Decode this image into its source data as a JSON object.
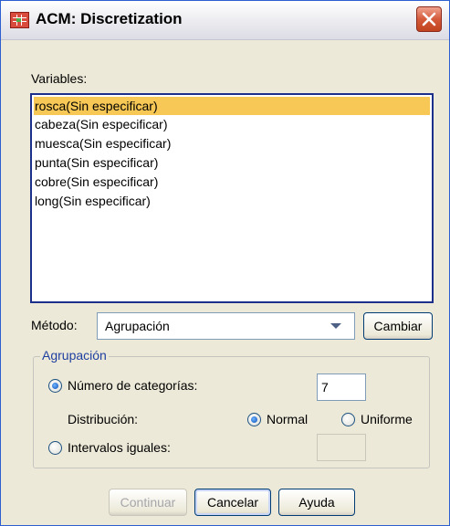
{
  "window": {
    "title": "ACM: Discretization"
  },
  "variables": {
    "label": "Variables:",
    "items": [
      {
        "label": "rosca(Sin especificar)",
        "selected": true
      },
      {
        "label": "cabeza(Sin especificar)",
        "selected": false
      },
      {
        "label": "muesca(Sin especificar)",
        "selected": false
      },
      {
        "label": "punta(Sin especificar)",
        "selected": false
      },
      {
        "label": "cobre(Sin especificar)",
        "selected": false
      },
      {
        "label": "long(Sin especificar)",
        "selected": false
      }
    ]
  },
  "method": {
    "label": "Método:",
    "selected": "Agrupación",
    "change_button": "Cambiar"
  },
  "grouping": {
    "title": "Agrupación",
    "num_categories": {
      "label": "Número de categorías:",
      "checked": true,
      "value": "7"
    },
    "distribution": {
      "label": "Distribución:",
      "normal": {
        "label": "Normal",
        "checked": true
      },
      "uniform": {
        "label": "Uniforme",
        "checked": false
      }
    },
    "equal_intervals": {
      "label": "Intervalos iguales:",
      "checked": false,
      "value": ""
    }
  },
  "buttons": {
    "continue": "Continuar",
    "cancel": "Cancelar",
    "help": "Ayuda"
  },
  "colors": {
    "selection": "#f7c855",
    "window_bg": "#ece9d8",
    "group_title": "#1f3fa0"
  }
}
